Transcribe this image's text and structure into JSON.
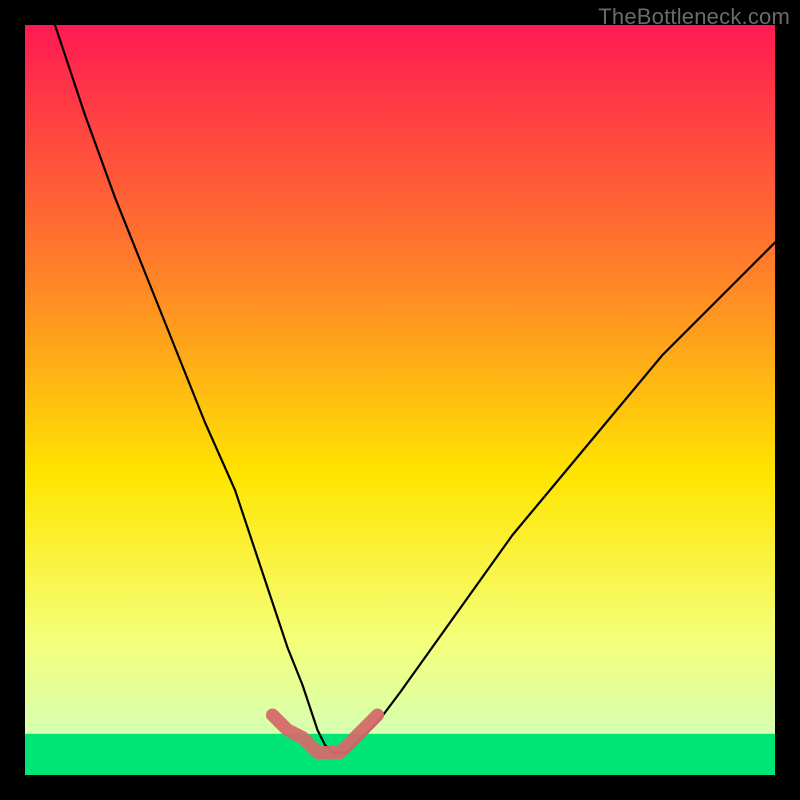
{
  "watermark": "TheBottleneck.com",
  "chart_data": {
    "type": "line",
    "title": "",
    "xlabel": "",
    "ylabel": "",
    "xlim": [
      0,
      100
    ],
    "ylim": [
      0,
      100
    ],
    "grid": false,
    "series": [
      {
        "name": "bottleneck-curve",
        "color": "#000000",
        "x": [
          4,
          8,
          12,
          16,
          20,
          24,
          28,
          31,
          33,
          35,
          37,
          38,
          39,
          40,
          41,
          42,
          43,
          44,
          45,
          47,
          50,
          55,
          60,
          65,
          70,
          75,
          80,
          85,
          90,
          95,
          100
        ],
        "values": [
          100,
          88,
          77,
          67,
          57,
          47,
          38,
          29,
          23,
          17,
          12,
          9,
          6,
          4,
          3,
          3,
          3,
          4,
          5,
          7,
          11,
          18,
          25,
          32,
          38,
          44,
          50,
          56,
          61,
          66,
          71
        ]
      },
      {
        "name": "low-bottleneck-highlight",
        "color": "#d46a6a",
        "x": [
          33,
          35,
          37,
          38,
          39,
          40,
          41,
          42,
          43,
          44,
          45,
          47
        ],
        "values": [
          8,
          6,
          5,
          4,
          3,
          3,
          3,
          3,
          4,
          5,
          6,
          8
        ]
      }
    ],
    "background_gradient": {
      "top": "#ff1a52",
      "mid1": "#ff7d2a",
      "mid2": "#ffe500",
      "mid3": "#f4ff7a",
      "bottom_band_top": "#d6ffb0",
      "bottom": "#00e676"
    },
    "green_band_fraction": 0.055
  }
}
